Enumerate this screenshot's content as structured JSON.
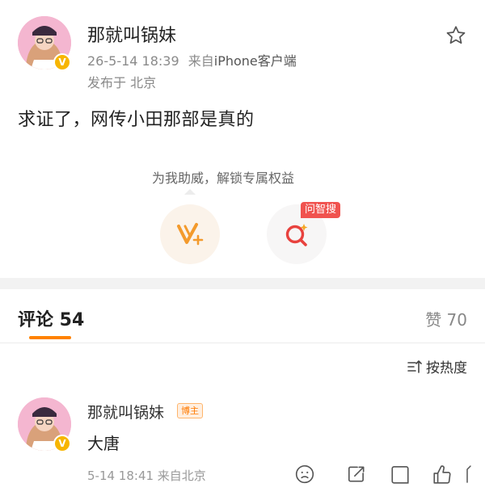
{
  "post": {
    "author_name": "那就叫锅妹",
    "time": "26-5-14 18:39",
    "source_prefix": "来自",
    "device": "iPhone客户端",
    "location": "发布于 北京",
    "body": "求证了，网传小田那部是真的"
  },
  "support": {
    "prompt": "为我助威，解锁专属权益",
    "ask_badge": "问智搜"
  },
  "tabs": {
    "comments_label": "评论 54",
    "likes_label": "赞 70"
  },
  "sort": {
    "label": "按热度"
  },
  "comment": {
    "author_name": "那就叫锅妹",
    "badge": "博主",
    "text": "大唐",
    "meta": "5-14 18:41 来自北京"
  },
  "colors": {
    "accent": "#ff8200",
    "verified": "#f7b500",
    "ask_badge": "#f0534f"
  },
  "icons": [
    "star-icon",
    "vplus-icon",
    "search-ai-icon",
    "sort-icon",
    "face-icon",
    "share-icon",
    "comment-icon",
    "like-icon"
  ]
}
